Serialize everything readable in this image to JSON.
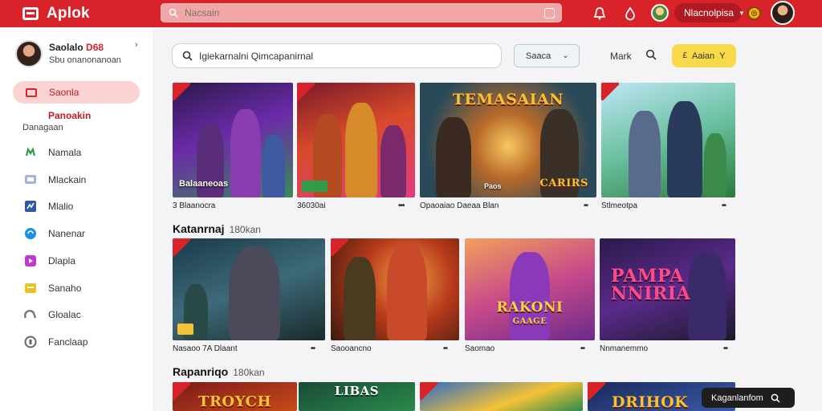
{
  "app": {
    "name": "Aplok"
  },
  "topbar": {
    "search_placeholder": "Nacsain",
    "user_menu_label": "Nlacnolpisa",
    "coin_glyph": "◎",
    "brand_color": "#d8232a"
  },
  "sidebar": {
    "profile": {
      "name": "Saolalo",
      "badge": "D68",
      "subtitle": "Sbu onanonanoan"
    },
    "active_item": "Saonla",
    "active_sub": "Panoakin",
    "section_label": "Danagaan",
    "items": [
      {
        "label": "Namala",
        "icon": "controller-icon",
        "color": "#2e9c4a"
      },
      {
        "label": "Mlackain",
        "icon": "chat-icon",
        "color": "#5b7fd6"
      },
      {
        "label": "Mlalio",
        "icon": "chart-icon",
        "color": "#2b5aa8"
      },
      {
        "label": "Nanenar",
        "icon": "globe-icon",
        "color": "#1b8fe0"
      },
      {
        "label": "Dlapla",
        "icon": "video-icon",
        "color": "#c13ad0"
      },
      {
        "label": "Sanaho",
        "icon": "folder-icon",
        "color": "#f0c220"
      },
      {
        "label": "Gloalac",
        "icon": "cloud-icon",
        "color": "#777777"
      },
      {
        "label": "Fanclaap",
        "icon": "shield-icon",
        "color": "#666666"
      }
    ]
  },
  "toolbar": {
    "search_value": "Igiekarnalni Qimcapanirnal",
    "sort_label": "Saaca",
    "mark_label": "Mark",
    "yellow_button_label": "Aaian",
    "yellow_button_prefix": "£",
    "yellow_button_suffix": "Y"
  },
  "sections": [
    {
      "title": "Katanrnaj",
      "count": "180kan"
    },
    {
      "title": "Rapanriqo",
      "count": "180kan"
    }
  ],
  "rows": {
    "row1": [
      {
        "label": "3 Blaanocra",
        "caption": "Balaaneoas",
        "title": ""
      },
      {
        "label": "36030ai",
        "caption": "",
        "title": ""
      },
      {
        "label": "Opaoaiao Daeaa Blan",
        "caption": "Paos",
        "title": "TEMASAIAN",
        "title2": "CARIRS"
      },
      {
        "label": "Stlmeotpa",
        "caption": "",
        "title": ""
      }
    ],
    "row2": [
      {
        "label": "Nasaoo 7A Dlaant",
        "caption": "",
        "title": ""
      },
      {
        "label": "Saooancno",
        "caption": "",
        "title": ""
      },
      {
        "label": "Saomao",
        "caption": "",
        "title": "RAKONI",
        "title2": "GAAGE"
      },
      {
        "label": "Nnmanemmo",
        "caption": "",
        "title": "PAMPA NNIRIA"
      }
    ],
    "row3": [
      {
        "title": "TROYCH"
      },
      {
        "title": "LIBAS"
      },
      {
        "title": ""
      },
      {
        "title": "DRIHOK"
      }
    ]
  },
  "tooltip": {
    "label": "Kaganlanfom"
  }
}
